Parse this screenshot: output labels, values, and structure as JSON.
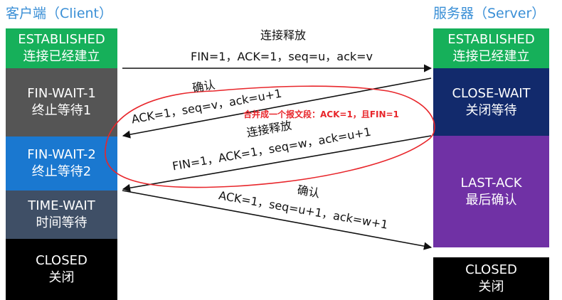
{
  "client": {
    "title": "客户端（Client）",
    "states": [
      {
        "line1": "ESTABLISHED",
        "line2": "连接已经建立",
        "color": "#16b05a"
      },
      {
        "line1": "FIN-WAIT-1",
        "line2": "终止等待1",
        "color": "#555555"
      },
      {
        "line1": "FIN-WAIT-2",
        "line2": "终止等待2",
        "color": "#1a78d0"
      },
      {
        "line1": "TIME-WAIT",
        "line2": "时间等待",
        "color": "#3f4f66"
      },
      {
        "line1": "CLOSED",
        "line2": "关闭",
        "color": "#000000"
      }
    ]
  },
  "server": {
    "title": "服务器（Server）",
    "states": [
      {
        "line1": "ESTABLISHED",
        "line2": "连接已经建立",
        "color": "#16b05a"
      },
      {
        "line1": "CLOSE-WAIT",
        "line2": "关闭等待",
        "color": "#122a6c"
      },
      {
        "line1": "LAST-ACK",
        "line2": "最后确认",
        "color": "#7031a5"
      },
      {
        "line1": "CLOSED",
        "line2": "关闭",
        "color": "#000000"
      }
    ]
  },
  "messages": {
    "m1_label": "连接释放",
    "m1_fields": "FIN=1，ACK=1，seq=u，ack=v",
    "m2_label": "确认",
    "m2_fields": "ACK=1，seq=v，ack=u+1",
    "m3_label": "连接释放",
    "m3_fields": "FIN=1，ACK=1，seq=w，ack=u+1",
    "m4_label": "确认",
    "m4_fields": "ACK=1，seq=u+1，ack=w+1"
  },
  "annotation": {
    "text": "合并成一个报文段：ACK=1，且FIN=1",
    "color": "#e8262b"
  }
}
